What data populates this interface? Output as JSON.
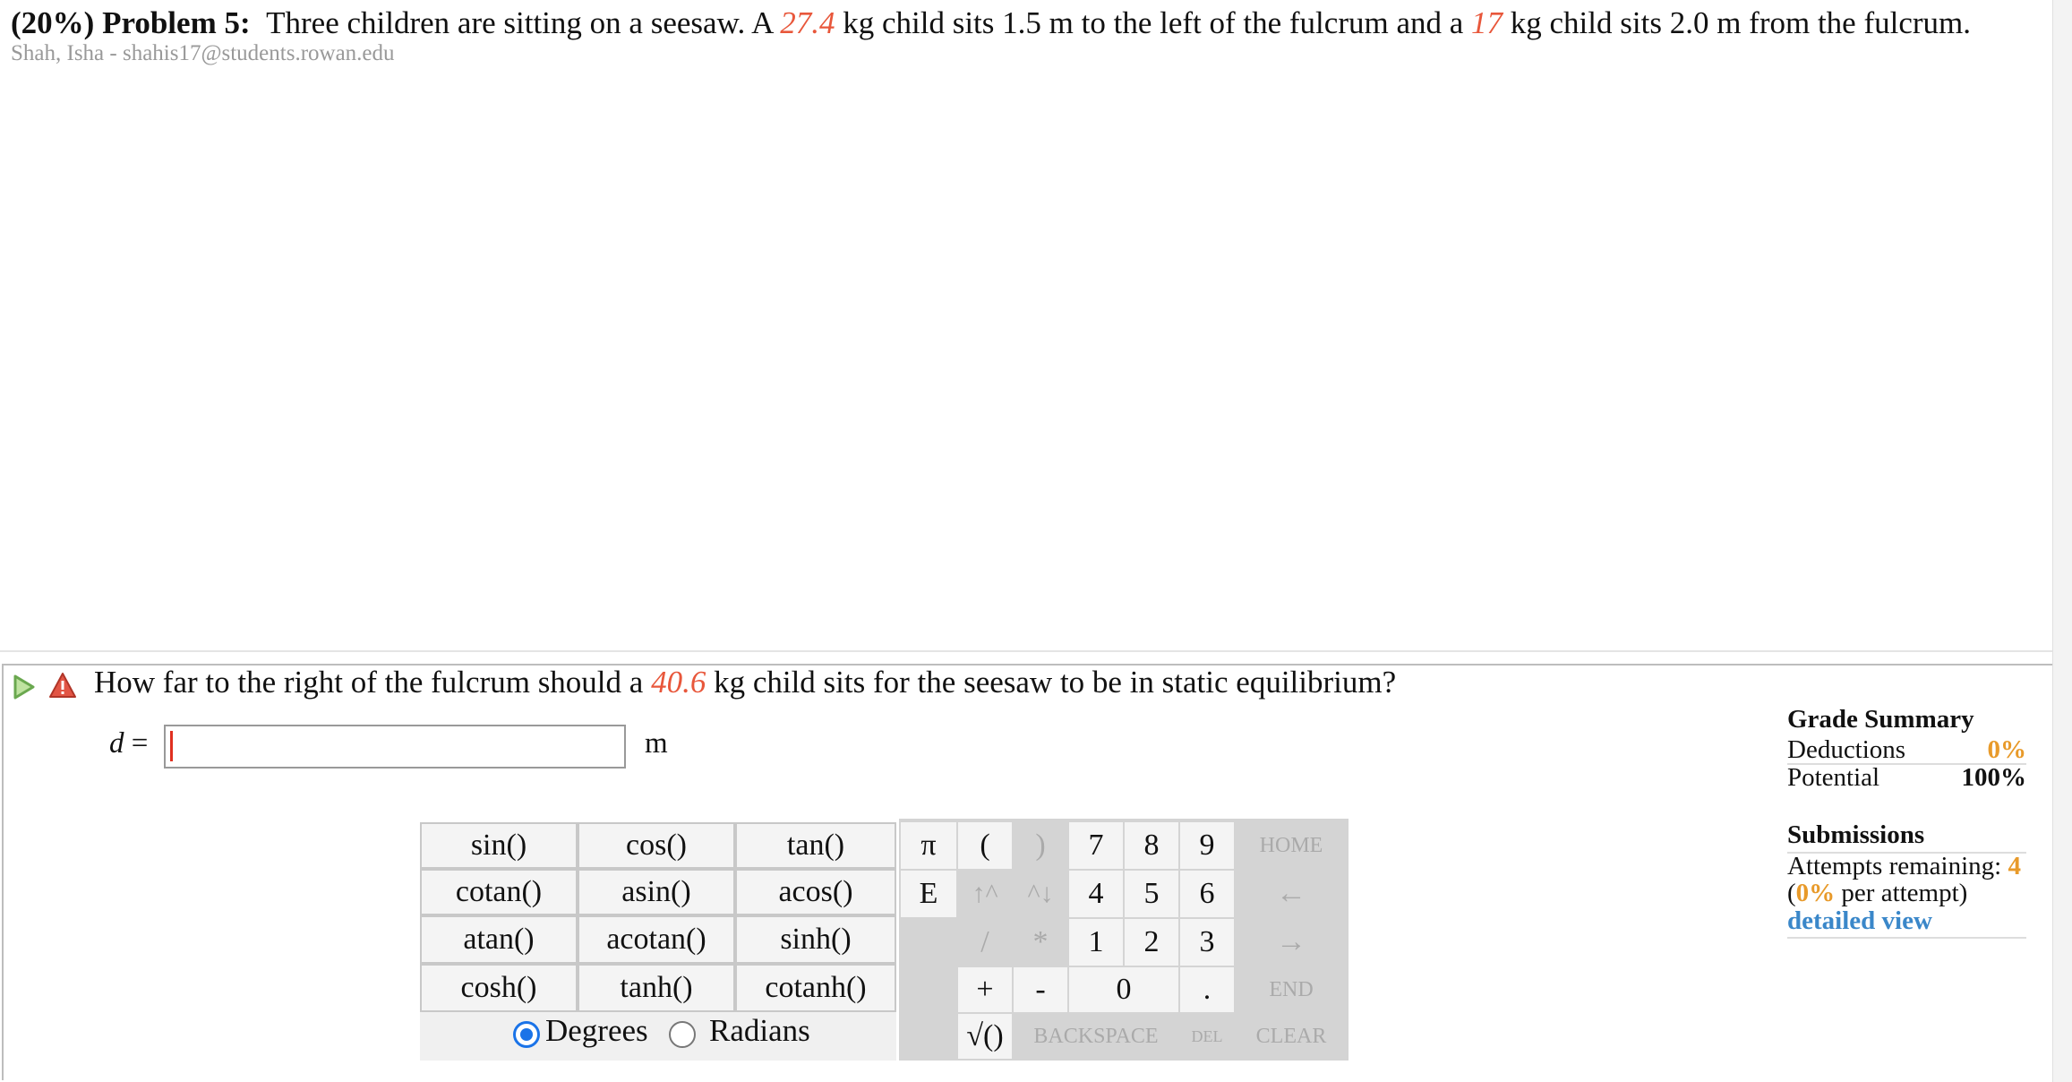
{
  "problem": {
    "percent": "(20%)",
    "label": "Problem 5:",
    "text_1": "Three children are sitting on a seesaw. A ",
    "mass_1": "27.4",
    "text_2": " kg child sits 1.5 m to the left of the fulcrum and a ",
    "mass_2": "17",
    "text_3": " kg child sits 2.0 m from the fulcrum."
  },
  "student": "Shah, Isha - shahis17@students.rowan.edu",
  "question": {
    "text_1": "How far to the right of the fulcrum should a ",
    "mass": "40.6",
    "text_2": " kg child sits for the seesaw to be in static equilibrium?"
  },
  "answer": {
    "variable": "d",
    "equals": "=",
    "value": "",
    "unit": "m"
  },
  "keypad": {
    "functions": [
      [
        "sin()",
        "cos()",
        "tan()"
      ],
      [
        "cotan()",
        "asin()",
        "acos()"
      ],
      [
        "atan()",
        "acotan()",
        "sinh()"
      ],
      [
        "cosh()",
        "tanh()",
        "cotanh()"
      ]
    ],
    "pi": "π",
    "e": "E",
    "open_paren": "(",
    "close_paren": ")",
    "up": "↑^",
    "down": "^↓",
    "divide": "/",
    "multiply": "*",
    "plus": "+",
    "minus": "-",
    "dot": ".",
    "sqrt": "√()",
    "digits": [
      "7",
      "8",
      "9",
      "4",
      "5",
      "6",
      "1",
      "2",
      "3",
      "0"
    ],
    "home": "HOME",
    "left": "←",
    "right": "→",
    "end": "END",
    "backspace": "BACKSPACE",
    "del": "DEL",
    "clear": "CLEAR",
    "degrees": "Degrees",
    "radians": "Radians"
  },
  "grade_summary": {
    "title": "Grade Summary",
    "deductions_label": "Deductions",
    "deductions_value": "0%",
    "potential_label": "Potential",
    "potential_value": "100%"
  },
  "submissions": {
    "title": "Submissions",
    "attempts_label": "Attempts remaining: ",
    "attempts_value": "4",
    "per_open": "(",
    "per_value": "0%",
    "per_label": " per attempt)",
    "link": "detailed view"
  },
  "colors": {
    "highlight": "#e8573b",
    "accent": "#e89a2a",
    "link": "#3a87c9",
    "radio": "#1a73e8"
  }
}
